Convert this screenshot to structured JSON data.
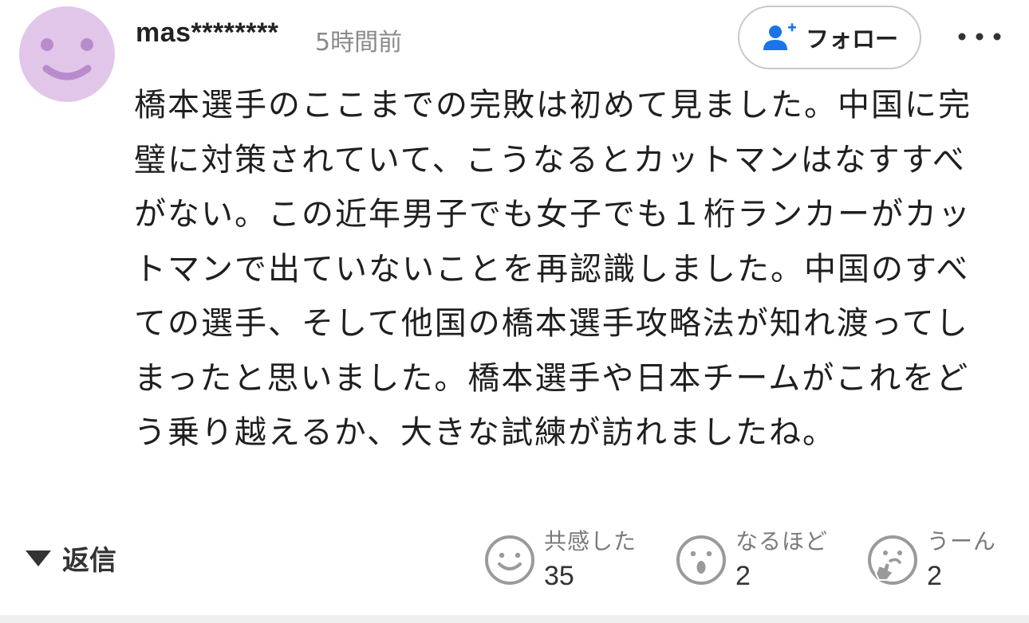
{
  "comment": {
    "username": "mas********",
    "timestamp": "5時間前",
    "follow_label": "フォロー",
    "body": "橋本選手のここまでの完敗は初めて見ました。中国に完璧に対策されていて、こうなるとカットマンはなすすべがない。この近年男子でも女子でも１桁ランカーがカットマンで出ていないことを再認識しました。中国のすべての選手、そして他国の橋本選手攻略法が知れ渡ってしまったと思いました。橋本選手や日本チームがこれをどう乗り越えるか、大きな試練が訪れましたね。",
    "reply_label": "返信"
  },
  "reactions": [
    {
      "label": "共感した",
      "count": "35",
      "icon": "smile-face-icon"
    },
    {
      "label": "なるほど",
      "count": "2",
      "icon": "surprised-face-icon"
    },
    {
      "label": "うーん",
      "count": "2",
      "icon": "thinking-face-icon"
    }
  ],
  "colors": {
    "avatar_bg": "#e2c6ea",
    "avatar_face": "#b88ccc",
    "follow_icon": "#1a73e8",
    "muted_text": "#8a8a8a",
    "reaction_icon": "#9a9a9a"
  }
}
